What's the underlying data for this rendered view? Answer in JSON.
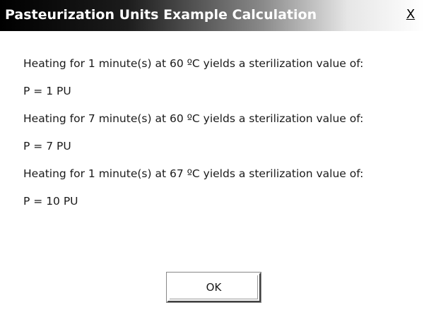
{
  "window": {
    "title": "Pasteurization Units Example Calculation",
    "close_label": "X"
  },
  "messages": [
    {
      "text": "Heating for 1 minute(s) at 60 ºC yields a sterilization value of:",
      "result": "P = 1 PU"
    },
    {
      "text": "Heating for 7 minute(s) at 60 ºC yields a sterilization value of:",
      "result": "P = 7 PU"
    },
    {
      "text": "Heating for 1 minute(s) at 67 ºC yields a sterilization value of:",
      "result": "P = 10 PU"
    }
  ],
  "buttons": {
    "ok_label": "OK"
  }
}
